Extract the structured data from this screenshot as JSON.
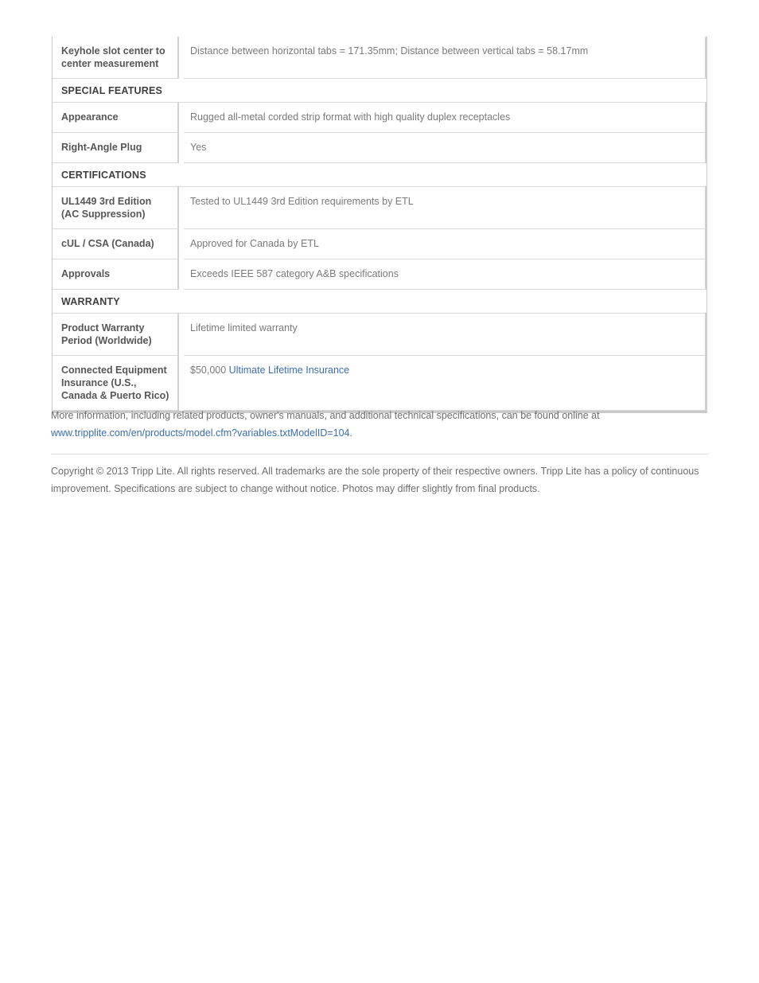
{
  "spec_table": {
    "rows": [
      {
        "kind": "data",
        "label": "Keyhole slot center to center measurement",
        "value": "Distance between horizontal tabs = 171.35mm; Distance between vertical tabs = 58.17mm"
      },
      {
        "kind": "section",
        "label": "SPECIAL FEATURES"
      },
      {
        "kind": "data",
        "label": "Appearance",
        "value": "Rugged all-metal corded strip format with high quality duplex receptacles"
      },
      {
        "kind": "data",
        "label": "Right-Angle Plug",
        "value": "Yes"
      },
      {
        "kind": "section",
        "label": "CERTIFICATIONS"
      },
      {
        "kind": "data",
        "label": "UL1449 3rd Edition (AC Suppression)",
        "value": "Tested to UL1449 3rd Edition requirements by ETL"
      },
      {
        "kind": "data",
        "label": "cUL / CSA (Canada)",
        "value": "Approved for Canada by ETL"
      },
      {
        "kind": "data",
        "label": "Approvals",
        "value": "Exceeds IEEE 587 category A&B specifications"
      },
      {
        "kind": "section",
        "label": "WARRANTY"
      },
      {
        "kind": "data",
        "label": "Product Warranty Period (Worldwide)",
        "value": "Lifetime limited warranty"
      },
      {
        "kind": "data",
        "label": "Connected Equipment Insurance (U.S., Canada & Puerto Rico)",
        "value_prefix": "$50,000 ",
        "value_link": "Ultimate Lifetime Insurance"
      }
    ]
  },
  "footer": {
    "more_info_text": "More information, including related products, owner's manuals, and additional technical specifications, can be found online at ",
    "more_info_link": "www.tripplite.com/en/products/model.cfm?variables.txtModelID=104",
    "more_info_period": ".",
    "copyright": "Copyright © 2013 Tripp Lite. All rights reserved. All trademarks are the sole property of their respective owners. Tripp Lite has a policy of continuous improvement. Specifications are subject to change without notice. Photos may differ slightly from final products."
  },
  "colors": {
    "link": "#3c6eb4",
    "label_text": "#575757",
    "value_text": "#7b7b7b",
    "section_text": "#3f3f3f",
    "border": "#d9d9d9"
  }
}
